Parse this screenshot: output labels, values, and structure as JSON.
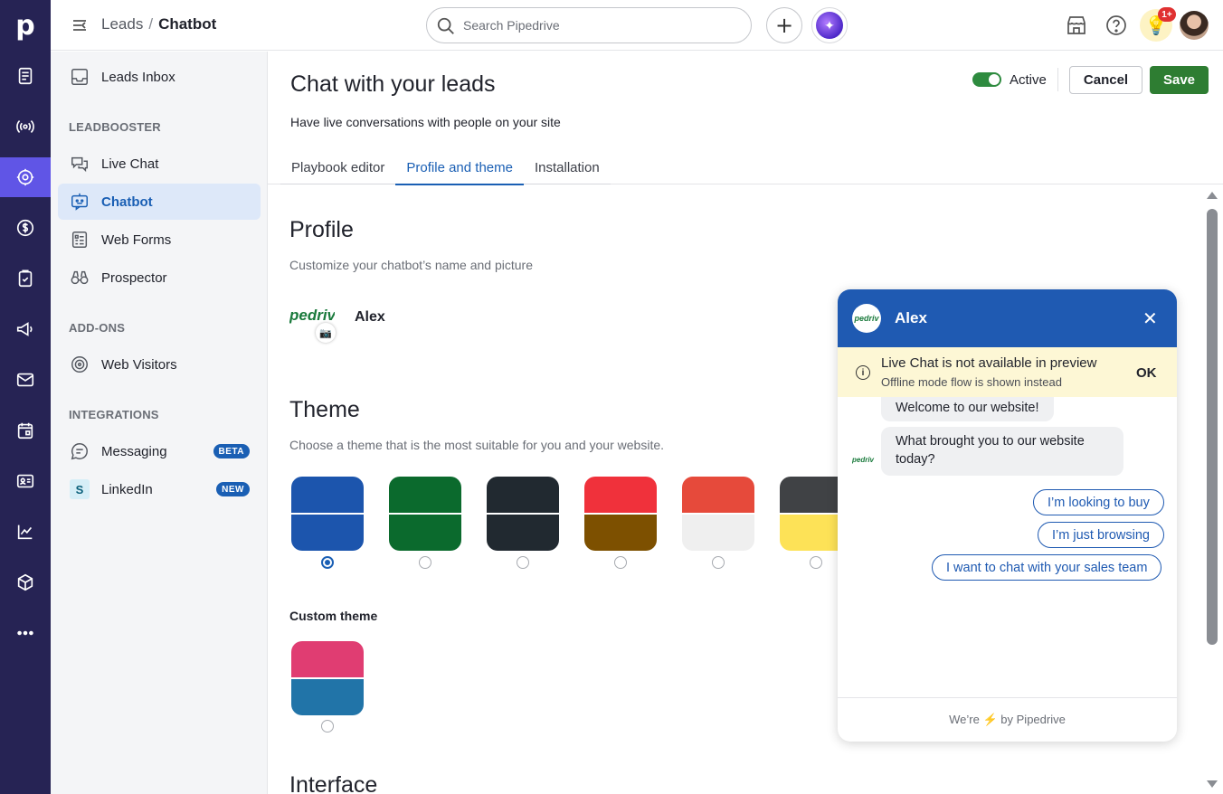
{
  "app": {
    "logo": "p",
    "breadcrumb": [
      "Leads",
      "Chatbot"
    ],
    "search_placeholder": "Search Pipedrive",
    "notification_badge": "1+",
    "rail_icons": [
      "leads-icon",
      "broadcast-icon",
      "target-icon",
      "deals-icon",
      "activities-icon",
      "campaigns-icon",
      "mail-icon",
      "calendar-icon",
      "contacts-icon",
      "insights-icon",
      "products-icon",
      "more-icon"
    ]
  },
  "sidebar": {
    "top_item": "Leads Inbox",
    "sections": [
      {
        "heading": "LEADBOOSTER",
        "items": [
          "Live Chat",
          "Chatbot",
          "Web Forms",
          "Prospector"
        ]
      },
      {
        "heading": "ADD-ONS",
        "items": [
          "Web Visitors"
        ]
      },
      {
        "heading": "INTEGRATIONS",
        "items": [
          "Messaging",
          "LinkedIn"
        ]
      }
    ],
    "tags": {
      "messaging": "BETA",
      "linkedin": "NEW"
    },
    "active": "Chatbot"
  },
  "main": {
    "title": "Chat with your leads",
    "subtitle": "Have live conversations with people on your site",
    "toggle_label": "Active",
    "toggle_on": true,
    "cancel_label": "Cancel",
    "save_label": "Save",
    "tabs": [
      "Playbook editor",
      "Profile and theme",
      "Installation"
    ],
    "active_tab": "Profile and theme",
    "profile": {
      "title": "Profile",
      "subtitle": "Customize your chatbot’s name and picture",
      "logo_text": "pedriv",
      "bot_name": "Alex"
    },
    "theme": {
      "title": "Theme",
      "subtitle": "Choose a theme that is the most suitable for you and your website.",
      "swatches": [
        {
          "top": "#1c55ad",
          "bottom": "#1c55ad",
          "selected": true
        },
        {
          "top": "#0b6a2d",
          "bottom": "#0b6a2d",
          "selected": false
        },
        {
          "top": "#212930",
          "bottom": "#212930",
          "selected": false
        },
        {
          "top": "#f0313b",
          "bottom": "#7d5000",
          "selected": false
        },
        {
          "top": "#e64a3b",
          "bottom": "#efefef",
          "selected": false
        },
        {
          "top": "#404245",
          "bottom": "#fde257",
          "selected": false
        }
      ],
      "custom_label": "Custom theme",
      "custom_swatch": {
        "top": "#e03d72",
        "bottom": "#2174a8",
        "selected": false
      }
    },
    "next_section_title": "Interface"
  },
  "chat": {
    "name": "Alex",
    "avatar_text": "pedriv",
    "notice_title": "Live Chat is not available in preview",
    "notice_sub": "Offline mode flow is shown instead",
    "notice_ok": "OK",
    "messages": [
      "Welcome to our website!",
      "What brought you to our website today?"
    ],
    "replies": [
      "I’m looking to buy",
      "I’m just browsing",
      "I want to chat with your sales team"
    ],
    "footer_pre": "We’re",
    "footer_post": "by Pipedrive"
  }
}
